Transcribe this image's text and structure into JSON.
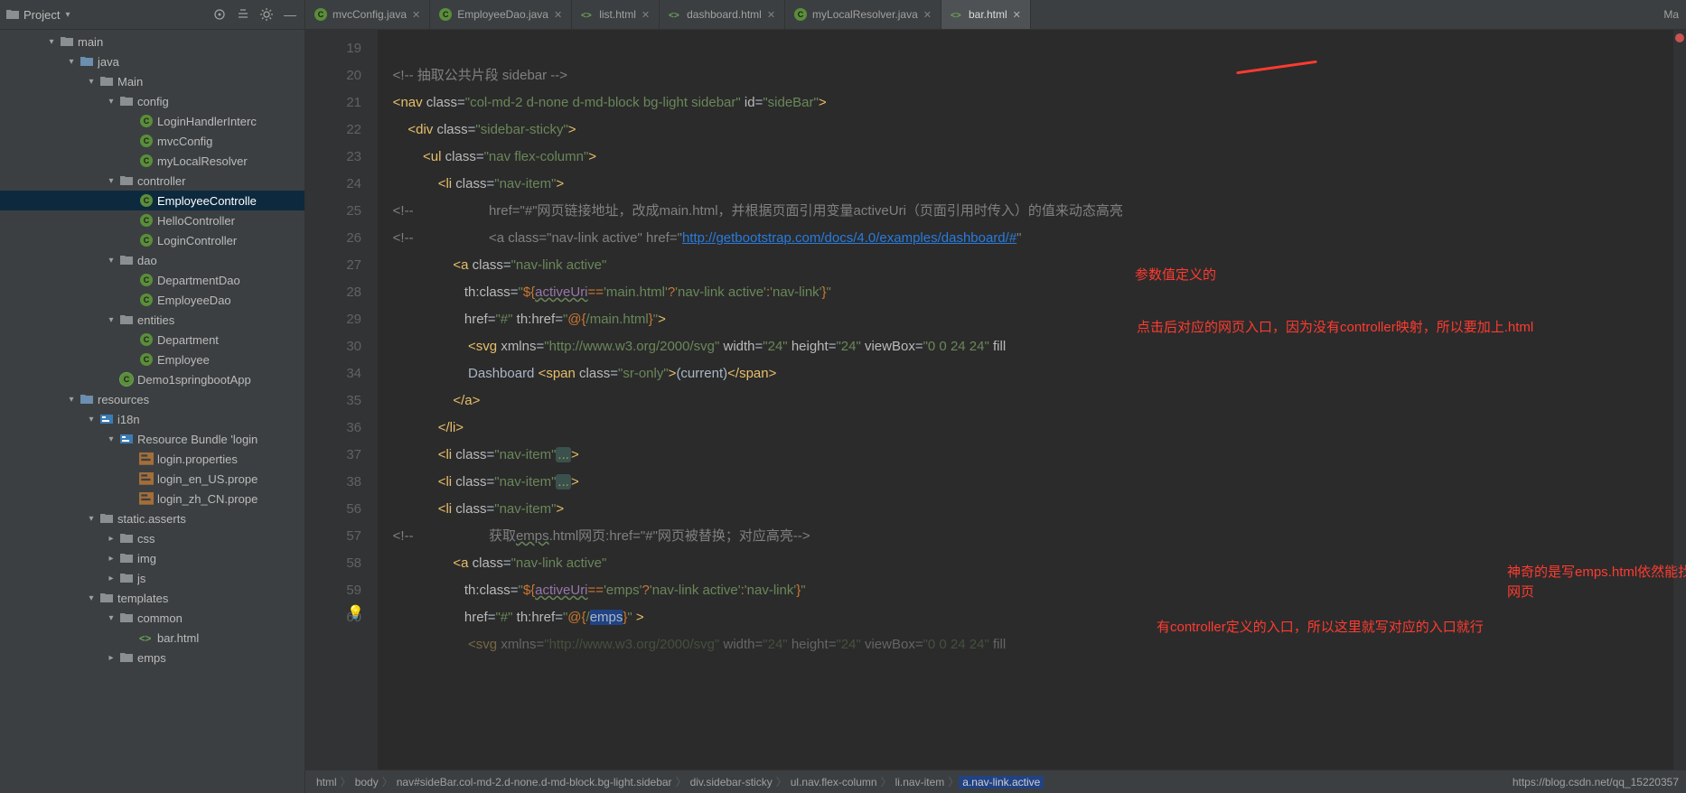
{
  "projectPanel": {
    "title": "Project",
    "tree": [
      {
        "indent": 52,
        "arrow": "▾",
        "icon": "folder",
        "label": "main"
      },
      {
        "indent": 74,
        "arrow": "▾",
        "icon": "folder-src",
        "label": "java"
      },
      {
        "indent": 96,
        "arrow": "▾",
        "icon": "folder",
        "label": "Main"
      },
      {
        "indent": 118,
        "arrow": "▾",
        "icon": "folder",
        "label": "config"
      },
      {
        "indent": 140,
        "arrow": "",
        "icon": "class",
        "label": "LoginHandlerInterc"
      },
      {
        "indent": 140,
        "arrow": "",
        "icon": "class",
        "label": "mvcConfig"
      },
      {
        "indent": 140,
        "arrow": "",
        "icon": "class",
        "label": "myLocalResolver"
      },
      {
        "indent": 118,
        "arrow": "▾",
        "icon": "folder",
        "label": "controller"
      },
      {
        "indent": 140,
        "arrow": "",
        "icon": "class",
        "label": "EmployeeControlle",
        "selected": true
      },
      {
        "indent": 140,
        "arrow": "",
        "icon": "class",
        "label": "HelloController"
      },
      {
        "indent": 140,
        "arrow": "",
        "icon": "class",
        "label": "LoginController"
      },
      {
        "indent": 118,
        "arrow": "▾",
        "icon": "folder",
        "label": "dao"
      },
      {
        "indent": 140,
        "arrow": "",
        "icon": "class",
        "label": "DepartmentDao"
      },
      {
        "indent": 140,
        "arrow": "",
        "icon": "class",
        "label": "EmployeeDao"
      },
      {
        "indent": 118,
        "arrow": "▾",
        "icon": "folder",
        "label": "entities"
      },
      {
        "indent": 140,
        "arrow": "",
        "icon": "class",
        "label": "Department"
      },
      {
        "indent": 140,
        "arrow": "",
        "icon": "class",
        "label": "Employee"
      },
      {
        "indent": 118,
        "arrow": "",
        "icon": "class-sp",
        "label": "Demo1springbootApp"
      },
      {
        "indent": 74,
        "arrow": "▾",
        "icon": "folder-src",
        "label": "resources"
      },
      {
        "indent": 96,
        "arrow": "▾",
        "icon": "bundle",
        "label": "i18n"
      },
      {
        "indent": 118,
        "arrow": "▾",
        "icon": "bundle",
        "label": "Resource Bundle 'login"
      },
      {
        "indent": 140,
        "arrow": "",
        "icon": "prop",
        "label": "login.properties"
      },
      {
        "indent": 140,
        "arrow": "",
        "icon": "prop",
        "label": "login_en_US.prope"
      },
      {
        "indent": 140,
        "arrow": "",
        "icon": "prop",
        "label": "login_zh_CN.prope"
      },
      {
        "indent": 96,
        "arrow": "▾",
        "icon": "folder",
        "label": "static.asserts"
      },
      {
        "indent": 118,
        "arrow": "▸",
        "icon": "folder",
        "label": "css"
      },
      {
        "indent": 118,
        "arrow": "▸",
        "icon": "folder",
        "label": "img"
      },
      {
        "indent": 118,
        "arrow": "▸",
        "icon": "folder",
        "label": "js"
      },
      {
        "indent": 96,
        "arrow": "▾",
        "icon": "folder",
        "label": "templates"
      },
      {
        "indent": 118,
        "arrow": "▾",
        "icon": "folder",
        "label": "common"
      },
      {
        "indent": 140,
        "arrow": "",
        "icon": "html",
        "label": "bar.html"
      },
      {
        "indent": 118,
        "arrow": "▸",
        "icon": "folder",
        "label": "emps"
      }
    ]
  },
  "tabs": [
    {
      "icon": "class",
      "label": "mvcConfig.java"
    },
    {
      "icon": "class",
      "label": "EmployeeDao.java"
    },
    {
      "icon": "html",
      "label": "list.html"
    },
    {
      "icon": "html",
      "label": "dashboard.html"
    },
    {
      "icon": "class",
      "label": "myLocalResolver.java"
    },
    {
      "icon": "html",
      "label": "bar.html",
      "active": true
    }
  ],
  "tabsRight": "Ma",
  "gutter": [
    "19",
    "20",
    "21",
    "22",
    "23",
    "24",
    "25",
    "26",
    "27",
    "28",
    "29",
    "30",
    "34",
    "35",
    "36",
    "37",
    "38",
    "56",
    "57",
    "58",
    "59",
    "60",
    ""
  ],
  "annotations": {
    "a1": "参数值定义的",
    "a2": "点击后对应的网页入口，因为没有controller映射，所以要加上.html",
    "a3": "神奇的是写emps.html依然能找到网页",
    "a4": "有controller定义的入口，所以这里就写对应的入口就行"
  },
  "breadcrumb": [
    "html",
    "body",
    "nav#sideBar.col-md-2.d-none.d-md-block.bg-light.sidebar",
    "div.sidebar-sticky",
    "ul.nav.flex-column",
    "li.nav-item",
    "a.nav-link.active"
  ],
  "footerUrl": "https://blog.csdn.net/qq_15220357"
}
